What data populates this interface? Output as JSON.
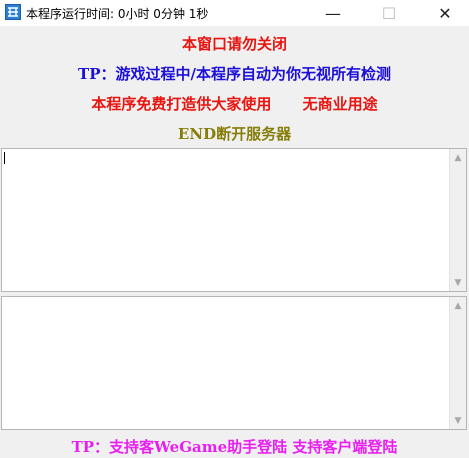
{
  "window": {
    "title": "本程序运行时间: 0小时 0分钟 1秒",
    "minimize_glyph": "—",
    "maximize_glyph": "☐",
    "close_glyph": "✕"
  },
  "notices": {
    "line1": "本窗口请勿关闭",
    "line2": "TP：游戏过程中/本程序自动为你无视所有检测",
    "line3": "本程序免费打造供大家使用      无商业用途",
    "line4": "END断开服务器",
    "footer": "TP：支持客WeGame助手登陆 支持客户端登陆"
  },
  "colors": {
    "red": "#e8140f",
    "blue": "#1c0fd8",
    "olive": "#877d0a",
    "magenta": "#e81ff0"
  },
  "textboxes": {
    "top_value": "",
    "bottom_value": ""
  },
  "icons": {
    "app": "app-icon",
    "scroll_up": "chevron-up-icon",
    "scroll_down": "chevron-down-icon"
  }
}
